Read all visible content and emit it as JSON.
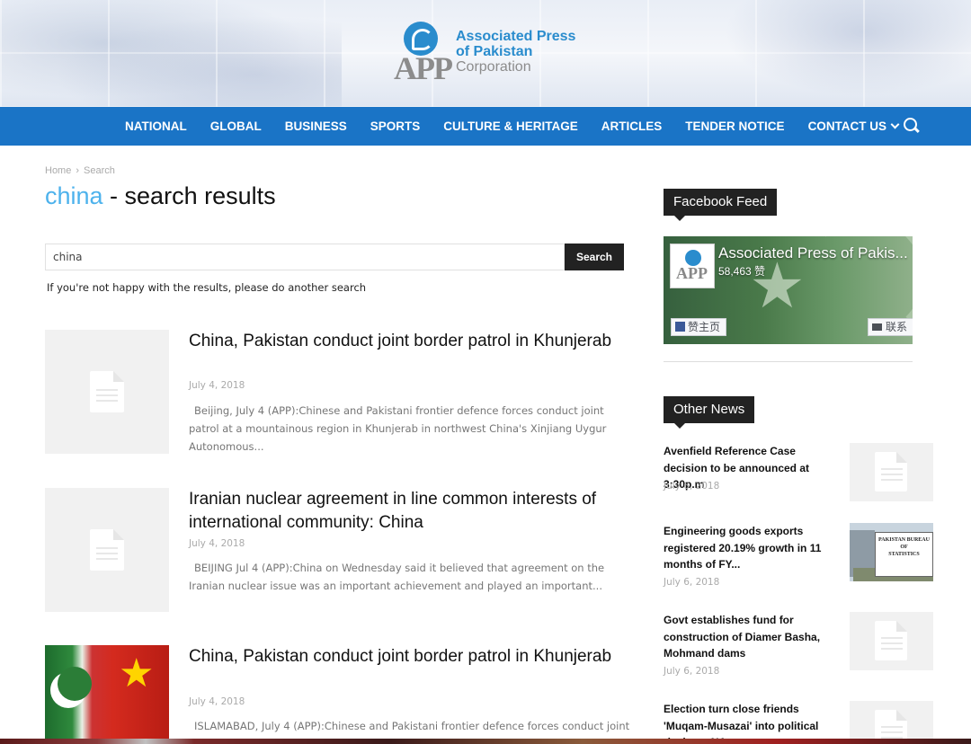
{
  "site": {
    "logo_mark": "APP",
    "logo_line1": "Associated Press",
    "logo_line2": "of Pakistan",
    "logo_line3": "Corporation"
  },
  "nav": {
    "items": [
      "NATIONAL",
      "GLOBAL",
      "BUSINESS",
      "SPORTS",
      "CULTURE & HERITAGE",
      "ARTICLES",
      "TENDER NOTICE",
      "CONTACT US"
    ],
    "search_icon": "search-icon"
  },
  "breadcrumb": {
    "home": "Home",
    "current": "Search"
  },
  "page": {
    "query": "china",
    "title_suffix": " - search results",
    "search_value": "china",
    "search_button": "Search",
    "hint": "If you're not happy with the results, please do another search"
  },
  "results": [
    {
      "title": "China, Pakistan conduct joint border patrol in Khunjerab",
      "date": "July 4, 2018",
      "excerpt": "Beijing, July 4 (APP):Chinese and Pakistani frontier defence forces conduct joint patrol at a mountainous region in Khunjerab in northwest China's Xinjiang Uygur Autonomous..."
    },
    {
      "title": "Iranian nuclear agreement in line common interests of international community: China",
      "date": "July 4, 2018",
      "excerpt": "BEIJING Jul 4 (APP):China on Wednesday said it believed that agreement on the Iranian nuclear issue was an important achievement and played an important..."
    },
    {
      "title": "China, Pakistan conduct joint border patrol in Khunjerab",
      "date": "July 4, 2018",
      "excerpt": "ISLAMABAD, July 4 (APP):Chinese and Pakistani frontier defence forces conduct joint"
    }
  ],
  "sidebar": {
    "facebook_title": "Facebook Feed",
    "facebook": {
      "page_name": "Associated Press of Pakis...",
      "likes": "58,463 赞",
      "like_button": "赞主页",
      "message_button": "联系"
    },
    "news_title": "Other News",
    "news": [
      {
        "title": "Avenfield Reference Case decision to be announced at 3:30p.m",
        "date": "July 6, 2018"
      },
      {
        "title": "Engineering goods exports registered 20.19% growth in 11 months of FY...",
        "date": "July 6, 2018",
        "thumb_text": [
          "PAKISTAN BUREAU",
          "OF",
          "STATISTICS"
        ]
      },
      {
        "title": "Govt establishes fund for construction of Diamer Basha, Mohmand dams",
        "date": "July 6, 2018"
      },
      {
        "title": "Election turn close friends 'Muqam-Musazai' into political rivals on NA-",
        "date": ""
      }
    ]
  }
}
